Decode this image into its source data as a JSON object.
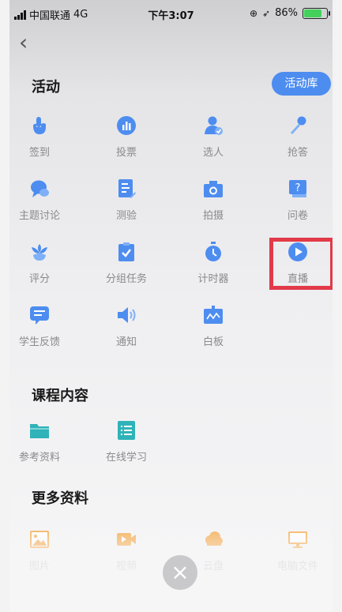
{
  "status": {
    "carrier": "中国联通",
    "network": "4G",
    "time": "下午3:07",
    "battery": "86%",
    "battery_level": 0.86
  },
  "nav": {
    "back_glyph": "‹"
  },
  "activities": {
    "title": "活动",
    "library_button": "活动库",
    "items": [
      {
        "label": "签到",
        "icon": "hand-tap-icon"
      },
      {
        "label": "投票",
        "icon": "bar-chart-icon"
      },
      {
        "label": "选人",
        "icon": "person-check-icon"
      },
      {
        "label": "抢答",
        "icon": "microphone-icon"
      },
      {
        "label": "主题讨论",
        "icon": "chat-bubble-icon"
      },
      {
        "label": "测验",
        "icon": "quiz-doc-icon"
      },
      {
        "label": "拍摄",
        "icon": "camera-icon"
      },
      {
        "label": "问卷",
        "icon": "question-card-icon"
      },
      {
        "label": "评分",
        "icon": "flower-icon"
      },
      {
        "label": "分组任务",
        "icon": "clipboard-check-icon"
      },
      {
        "label": "计时器",
        "icon": "stopwatch-icon"
      },
      {
        "label": "直播",
        "icon": "play-circle-icon"
      },
      {
        "label": "学生反馈",
        "icon": "feedback-chat-icon"
      },
      {
        "label": "通知",
        "icon": "speaker-icon"
      },
      {
        "label": "白板",
        "icon": "whiteboard-icon"
      }
    ]
  },
  "course": {
    "title": "课程内容",
    "items": [
      {
        "label": "参考资料",
        "icon": "folder-icon"
      },
      {
        "label": "在线学习",
        "icon": "list-doc-icon"
      }
    ]
  },
  "more": {
    "title": "更多资料",
    "items": [
      {
        "label": "图片",
        "icon": "image-icon"
      },
      {
        "label": "视频",
        "icon": "video-icon"
      },
      {
        "label": "云盘",
        "icon": "cloud-icon"
      },
      {
        "label": "电脑文件",
        "icon": "monitor-icon"
      }
    ]
  },
  "close_button": {
    "glyph": "×"
  },
  "colors": {
    "accent_blue": "#4e8df0",
    "highlight_red": "#e23a48",
    "teal": "#2fb3b8",
    "orange": "#f5a23a"
  }
}
